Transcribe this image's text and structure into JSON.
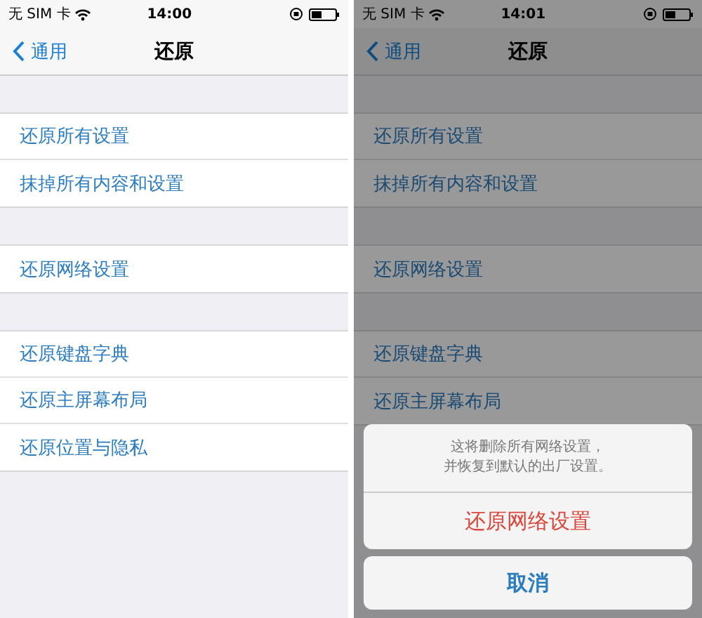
{
  "phones": [
    {
      "status": {
        "carrier": "无 SIM 卡",
        "time": "14:00"
      },
      "nav": {
        "back": "通用",
        "title": "还原"
      },
      "dimmed": false,
      "groups": [
        [
          "还原所有设置",
          "抹掉所有内容和设置"
        ],
        [
          "还原网络设置"
        ],
        [
          "还原键盘字典",
          "还原主屏幕布局",
          "还原位置与隐私"
        ]
      ]
    },
    {
      "status": {
        "carrier": "无 SIM 卡",
        "time": "14:01"
      },
      "nav": {
        "back": "通用",
        "title": "还原"
      },
      "dimmed": true,
      "groups": [
        [
          "还原所有设置",
          "抹掉所有内容和设置"
        ],
        [
          "还原网络设置"
        ],
        [
          "还原键盘字典",
          "还原主屏幕布局"
        ]
      ],
      "action_sheet": {
        "message": [
          "这将删除所有网络设置，",
          "并恢复到默认的出厂设置。"
        ],
        "destructive": "还原网络设置",
        "cancel": "取消"
      }
    }
  ]
}
